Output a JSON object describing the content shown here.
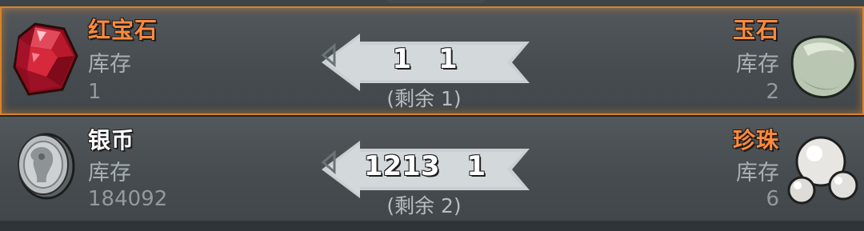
{
  "trades": [
    {
      "give_item": {
        "name": "红宝石",
        "stock_label": "库存",
        "stock": "1",
        "icon": "ruby-icon"
      },
      "get_item": {
        "name": "玉石",
        "stock_label": "库存",
        "stock": "2",
        "icon": "jade-icon"
      },
      "give_amount": "1",
      "get_amount": "1",
      "remaining": "(剩余 1)",
      "selected": true
    },
    {
      "give_item": {
        "name": "银币",
        "stock_label": "库存",
        "stock": "184092",
        "icon": "silver-coin-icon"
      },
      "get_item": {
        "name": "珍珠",
        "stock_label": "库存",
        "stock": "6",
        "icon": "pearl-icon"
      },
      "give_amount": "1213",
      "get_amount": "1",
      "remaining": "(剩余 2)",
      "selected": false
    }
  ],
  "colors": {
    "highlight": "#d9832a",
    "item_name_orange": "#ff8a3d",
    "arrow_fill": "#c9cfd2"
  }
}
